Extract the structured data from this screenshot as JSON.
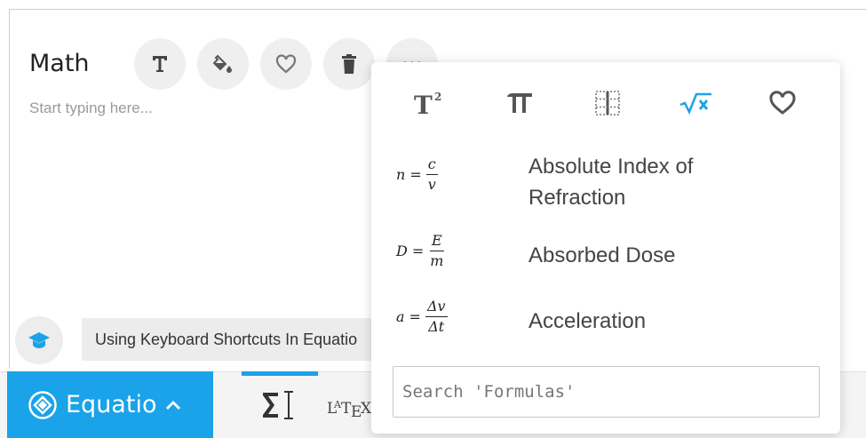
{
  "editor": {
    "title": "Math",
    "placeholder": "Start typing here..."
  },
  "toolbar_buttons": [
    {
      "name": "text",
      "icon": "text-format-icon"
    },
    {
      "name": "fill",
      "icon": "paint-bucket-icon"
    },
    {
      "name": "favorite",
      "icon": "heart-icon"
    },
    {
      "name": "delete",
      "icon": "trash-icon"
    },
    {
      "name": "more",
      "icon": "more-dots-icon"
    }
  ],
  "hint": {
    "icon": "graduation-cap-icon",
    "text": "Using Keyboard Shortcuts In Equatio"
  },
  "bottom_bar": {
    "brand": "Equatio",
    "brand_chevron": "^",
    "latex_label": "LATEX",
    "accent_color": "#1aa3e8"
  },
  "panel": {
    "tabs": [
      {
        "name": "superscript",
        "label": "T²"
      },
      {
        "name": "pi",
        "label": "π"
      },
      {
        "name": "matrix",
        "label": ""
      },
      {
        "name": "formulas",
        "label": "√x",
        "active": true
      },
      {
        "name": "favorites",
        "label": ""
      }
    ],
    "formulas": [
      {
        "lhs": "n",
        "num": "c",
        "den": "v",
        "name": "Absolute Index of Refraction"
      },
      {
        "lhs": "D",
        "num": "E",
        "den": "m",
        "name": "Absorbed Dose"
      },
      {
        "lhs": "a",
        "num": "Δv",
        "den": "Δt",
        "name": "Acceleration"
      }
    ],
    "search_placeholder": "Search 'Formulas'"
  }
}
